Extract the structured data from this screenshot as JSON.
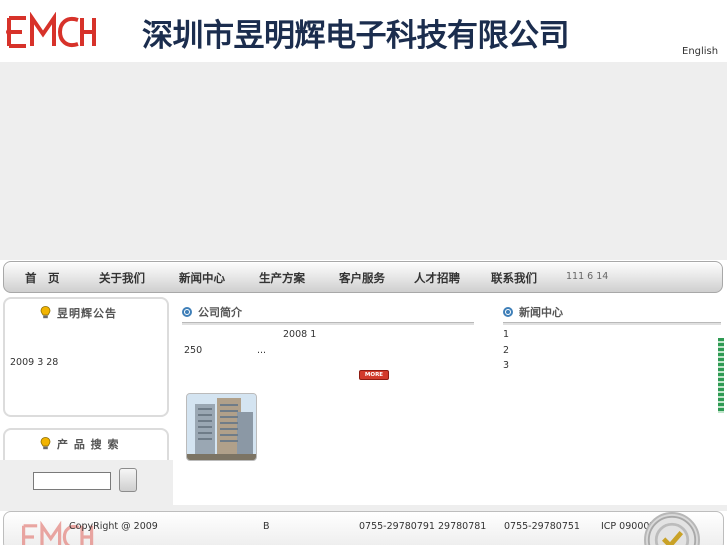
{
  "header": {
    "company_name": "深圳市昱明辉电子科技有限公司",
    "language_link": "English"
  },
  "nav": {
    "items": [
      "首　页",
      "关于我们",
      "新闻中心",
      "生产方案",
      "客户服务",
      "人才招聘",
      "联系我们"
    ],
    "date": "111  6  14"
  },
  "sidebar": {
    "notice_title": "昱明辉公告",
    "notice_text": "2009 3 28",
    "search_title": "产 品 搜 索",
    "search_value": ""
  },
  "about": {
    "title": "公司简介",
    "line1": "2008 1",
    "line2_a": "250",
    "line2_b": "...",
    "more_label": "MORE"
  },
  "news": {
    "title": "新闻中心",
    "items": [
      "1",
      "2",
      "3"
    ]
  },
  "footer": {
    "copyright": "CopyRight @ 2009",
    "letter": "B",
    "phone": "0755-29780791  29780781",
    "fax": "0755-29780751",
    "icp": "ICP  09000721"
  },
  "colors": {
    "brand_red": "#d7322a",
    "title_navy": "#1b2d4e",
    "accent_blue": "#3f7fb8"
  }
}
